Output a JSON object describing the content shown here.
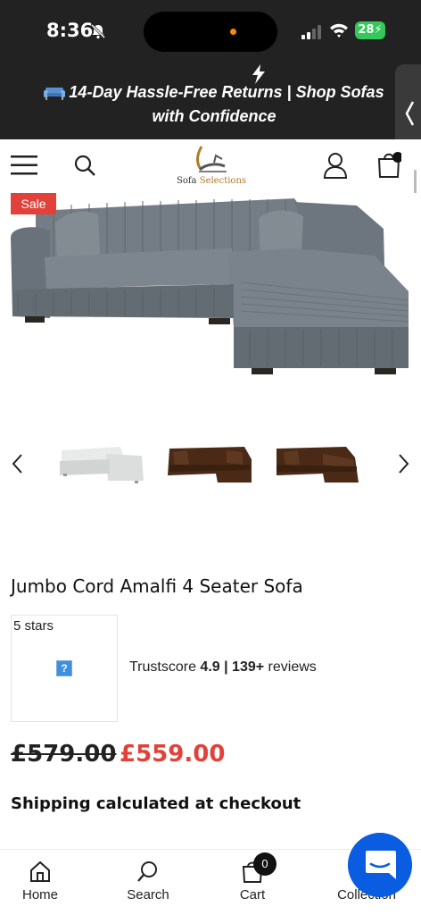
{
  "status": {
    "time": "8:36",
    "battery": "28"
  },
  "announcement": {
    "text": "14-Day Hassle-Free Returns | Shop Sofas with Confidence"
  },
  "header": {
    "logo_text_1": "Sofa",
    "logo_text_2": "Selections"
  },
  "product": {
    "badge": "Sale",
    "title": "Jumbo Cord Amalfi 4 Seater Sofa",
    "rating_label": "5 stars",
    "broken_image_glyph": "?",
    "trust_prefix": "Trustscore ",
    "trust_score": "4.9",
    "trust_sep": " | ",
    "trust_count": "139+",
    "trust_suffix": " reviews",
    "price_old": "£579.00",
    "price_new": "£559.00",
    "shipping": "Shipping calculated at checkout"
  },
  "colors": {
    "sale": "#e2413a",
    "dark_bar": "#222222",
    "chat": "#0a5de0",
    "sofa_grey": "#6f7880",
    "sofa_brown": "#4a2a16"
  },
  "bottom_nav": {
    "home": "Home",
    "search": "Search",
    "cart": "Cart",
    "cart_count": "0",
    "collection": "Collection"
  }
}
